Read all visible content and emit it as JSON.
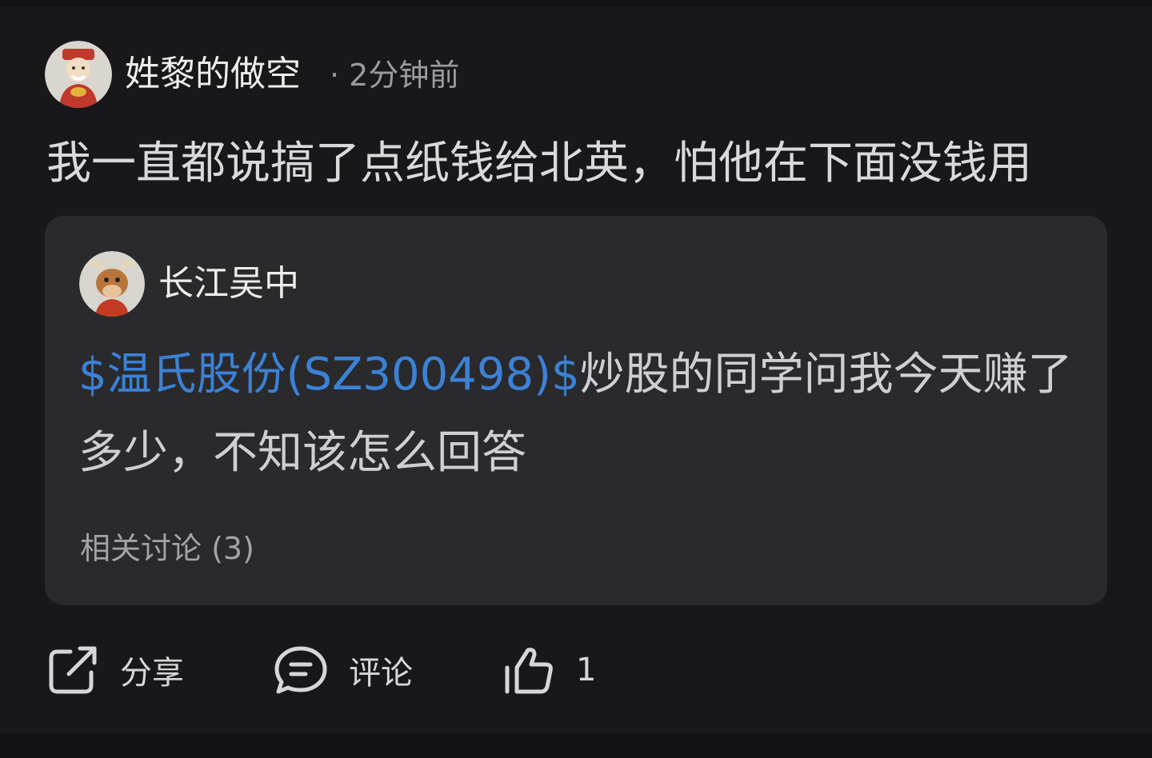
{
  "post": {
    "author": "姓黎的做空",
    "meta": "· 2分钟前",
    "text": "我一直都说搞了点纸钱给北英，怕他在下面没钱用"
  },
  "quoted": {
    "author": "长江吴中",
    "stock_link": "$温氏股份(SZ300498)$",
    "text": "炒股的同学问我今天赚了多少，不知该怎么回答",
    "related": "相关讨论 (3)"
  },
  "actions": {
    "share_label": "分享",
    "comment_label": "评论",
    "like_count": "1"
  },
  "colors": {
    "background": "#18181a",
    "card": "#2a2a2d",
    "link": "#3b82d6"
  },
  "icons": {
    "author_avatar": "god-of-wealth-avatar",
    "quoted_avatar": "cartoon-ox-avatar",
    "share": "share-icon",
    "comment": "comment-icon",
    "like": "thumbs-up-icon"
  }
}
